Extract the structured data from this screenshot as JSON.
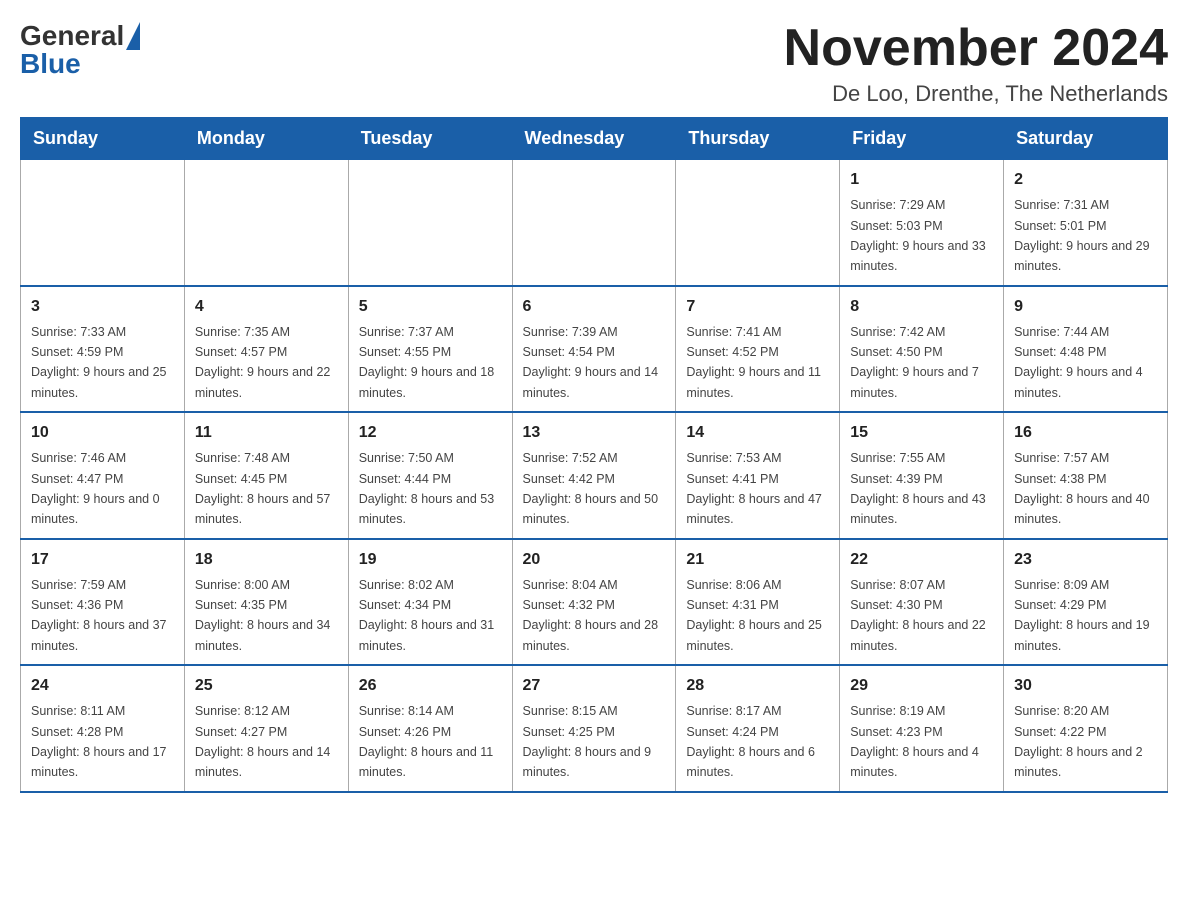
{
  "header": {
    "title": "November 2024",
    "subtitle": "De Loo, Drenthe, The Netherlands",
    "logo": {
      "general": "General",
      "blue": "Blue"
    }
  },
  "weekdays": [
    "Sunday",
    "Monday",
    "Tuesday",
    "Wednesday",
    "Thursday",
    "Friday",
    "Saturday"
  ],
  "weeks": [
    [
      {
        "day": "",
        "info": ""
      },
      {
        "day": "",
        "info": ""
      },
      {
        "day": "",
        "info": ""
      },
      {
        "day": "",
        "info": ""
      },
      {
        "day": "",
        "info": ""
      },
      {
        "day": "1",
        "info": "Sunrise: 7:29 AM\nSunset: 5:03 PM\nDaylight: 9 hours and 33 minutes."
      },
      {
        "day": "2",
        "info": "Sunrise: 7:31 AM\nSunset: 5:01 PM\nDaylight: 9 hours and 29 minutes."
      }
    ],
    [
      {
        "day": "3",
        "info": "Sunrise: 7:33 AM\nSunset: 4:59 PM\nDaylight: 9 hours and 25 minutes."
      },
      {
        "day": "4",
        "info": "Sunrise: 7:35 AM\nSunset: 4:57 PM\nDaylight: 9 hours and 22 minutes."
      },
      {
        "day": "5",
        "info": "Sunrise: 7:37 AM\nSunset: 4:55 PM\nDaylight: 9 hours and 18 minutes."
      },
      {
        "day": "6",
        "info": "Sunrise: 7:39 AM\nSunset: 4:54 PM\nDaylight: 9 hours and 14 minutes."
      },
      {
        "day": "7",
        "info": "Sunrise: 7:41 AM\nSunset: 4:52 PM\nDaylight: 9 hours and 11 minutes."
      },
      {
        "day": "8",
        "info": "Sunrise: 7:42 AM\nSunset: 4:50 PM\nDaylight: 9 hours and 7 minutes."
      },
      {
        "day": "9",
        "info": "Sunrise: 7:44 AM\nSunset: 4:48 PM\nDaylight: 9 hours and 4 minutes."
      }
    ],
    [
      {
        "day": "10",
        "info": "Sunrise: 7:46 AM\nSunset: 4:47 PM\nDaylight: 9 hours and 0 minutes."
      },
      {
        "day": "11",
        "info": "Sunrise: 7:48 AM\nSunset: 4:45 PM\nDaylight: 8 hours and 57 minutes."
      },
      {
        "day": "12",
        "info": "Sunrise: 7:50 AM\nSunset: 4:44 PM\nDaylight: 8 hours and 53 minutes."
      },
      {
        "day": "13",
        "info": "Sunrise: 7:52 AM\nSunset: 4:42 PM\nDaylight: 8 hours and 50 minutes."
      },
      {
        "day": "14",
        "info": "Sunrise: 7:53 AM\nSunset: 4:41 PM\nDaylight: 8 hours and 47 minutes."
      },
      {
        "day": "15",
        "info": "Sunrise: 7:55 AM\nSunset: 4:39 PM\nDaylight: 8 hours and 43 minutes."
      },
      {
        "day": "16",
        "info": "Sunrise: 7:57 AM\nSunset: 4:38 PM\nDaylight: 8 hours and 40 minutes."
      }
    ],
    [
      {
        "day": "17",
        "info": "Sunrise: 7:59 AM\nSunset: 4:36 PM\nDaylight: 8 hours and 37 minutes."
      },
      {
        "day": "18",
        "info": "Sunrise: 8:00 AM\nSunset: 4:35 PM\nDaylight: 8 hours and 34 minutes."
      },
      {
        "day": "19",
        "info": "Sunrise: 8:02 AM\nSunset: 4:34 PM\nDaylight: 8 hours and 31 minutes."
      },
      {
        "day": "20",
        "info": "Sunrise: 8:04 AM\nSunset: 4:32 PM\nDaylight: 8 hours and 28 minutes."
      },
      {
        "day": "21",
        "info": "Sunrise: 8:06 AM\nSunset: 4:31 PM\nDaylight: 8 hours and 25 minutes."
      },
      {
        "day": "22",
        "info": "Sunrise: 8:07 AM\nSunset: 4:30 PM\nDaylight: 8 hours and 22 minutes."
      },
      {
        "day": "23",
        "info": "Sunrise: 8:09 AM\nSunset: 4:29 PM\nDaylight: 8 hours and 19 minutes."
      }
    ],
    [
      {
        "day": "24",
        "info": "Sunrise: 8:11 AM\nSunset: 4:28 PM\nDaylight: 8 hours and 17 minutes."
      },
      {
        "day": "25",
        "info": "Sunrise: 8:12 AM\nSunset: 4:27 PM\nDaylight: 8 hours and 14 minutes."
      },
      {
        "day": "26",
        "info": "Sunrise: 8:14 AM\nSunset: 4:26 PM\nDaylight: 8 hours and 11 minutes."
      },
      {
        "day": "27",
        "info": "Sunrise: 8:15 AM\nSunset: 4:25 PM\nDaylight: 8 hours and 9 minutes."
      },
      {
        "day": "28",
        "info": "Sunrise: 8:17 AM\nSunset: 4:24 PM\nDaylight: 8 hours and 6 minutes."
      },
      {
        "day": "29",
        "info": "Sunrise: 8:19 AM\nSunset: 4:23 PM\nDaylight: 8 hours and 4 minutes."
      },
      {
        "day": "30",
        "info": "Sunrise: 8:20 AM\nSunset: 4:22 PM\nDaylight: 8 hours and 2 minutes."
      }
    ]
  ]
}
